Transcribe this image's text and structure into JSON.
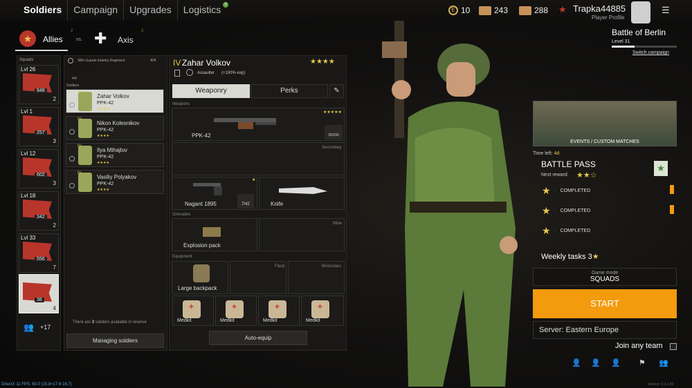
{
  "nav": {
    "tabs": [
      "Soldiers",
      "Campaign",
      "Upgrades",
      "Logistics"
    ],
    "logistics_badge": "0"
  },
  "resources": {
    "gold": "10",
    "tickets_a": "243",
    "tickets_b": "288"
  },
  "profile": {
    "name": "Trapka44885",
    "subtitle": "Player Profile"
  },
  "campaign": {
    "title": "Battle of Berlin",
    "level": "Level 31",
    "switch": "Switch campaign"
  },
  "factions": {
    "allies": "Allies",
    "allies_badge": "2",
    "vs": "vs.",
    "axis": "Axis",
    "axis_badge": "2"
  },
  "squads": {
    "label": "Squads",
    "items": [
      {
        "level": "Lvl 26",
        "count": "948",
        "num": "2"
      },
      {
        "level": "Lvl 1",
        "count": "257",
        "num": "3"
      },
      {
        "level": "Lvl 12",
        "count": "602",
        "num": "3"
      },
      {
        "level": "Lvl 18",
        "count": "342",
        "num": "2"
      },
      {
        "level": "Lvl 33",
        "count": "556",
        "num": "7"
      },
      {
        "level": "",
        "count": "38",
        "num": "4"
      }
    ],
    "extra": "+17"
  },
  "regiment": {
    "name": "38th Guards Infantry Regiment",
    "count": "4/4",
    "sub": "4/4",
    "soldiers_label": "Soldiers"
  },
  "soldiers": [
    {
      "name": "Zahar Volkov",
      "weapon": "PPK-42",
      "rank": "IV",
      "stars": "★★★★"
    },
    {
      "name": "Nikon Kolesnikov",
      "weapon": "PPK-42",
      "rank": "IV",
      "stars": "★★★★"
    },
    {
      "name": "Ilya Mihajlov",
      "weapon": "PPK-42",
      "rank": "IV",
      "stars": "★★★★"
    },
    {
      "name": "Vasiliy Polyakov",
      "weapon": "PPK-42",
      "rank": "IV",
      "stars": "★★★★"
    }
  ],
  "reserve": {
    "text_a": "There are ",
    "count": "3",
    "text_b": " soldiers available in reserve"
  },
  "managing": "Managing soldiers",
  "detail": {
    "rank": "IV",
    "name": "Zahar Volkov",
    "stars": "★★★★",
    "class": "Assaulter",
    "bonus": "(+100% exp)",
    "tab_weaponry": "Weaponry",
    "tab_perks": "Perks",
    "weapons_label": "Weapons",
    "primary": "PPK-42",
    "primary_stars": "★★★★★",
    "primary_ammo": "25/100",
    "secondary_label": "Secondary",
    "sidearm": "Nagant 1895",
    "sidearm_ammo": "7/42",
    "knife": "Knife",
    "grenades_label": "Grenades",
    "grenade": "Explosion pack",
    "mine_label": "Mine",
    "equipment_label": "Equipment",
    "backpack": "Large backpack",
    "flask_label": "Flask",
    "binoculars_label": "Binoculars",
    "medkit": "Medkit",
    "autoequip": "Auto-equip"
  },
  "events": {
    "label": "EVENTS / CUSTOM MATCHES"
  },
  "battlepass": {
    "time_left_label": "Time left:",
    "time_left": "4d",
    "title": "BATTLE PASS",
    "next_reward": "Next reward",
    "rows": [
      "COMPLETED",
      "COMPLETED",
      "COMPLETED"
    ]
  },
  "weekly": {
    "label": "Weekly tasks",
    "count": "3"
  },
  "gamemode": {
    "label": "Game mode",
    "value": "SQUADS"
  },
  "start": "START",
  "server": "Server: Eastern Europe",
  "join_any": "Join any team",
  "footer": {
    "fps": "DirectX 11 FPS: 60.0 (15.8<17.6 16.7)",
    "version": "Version: 0.3.1.80"
  },
  "colors": {
    "accent": "#f39b0d",
    "flag_red": "#b8352b",
    "star": "#e7c84a"
  }
}
